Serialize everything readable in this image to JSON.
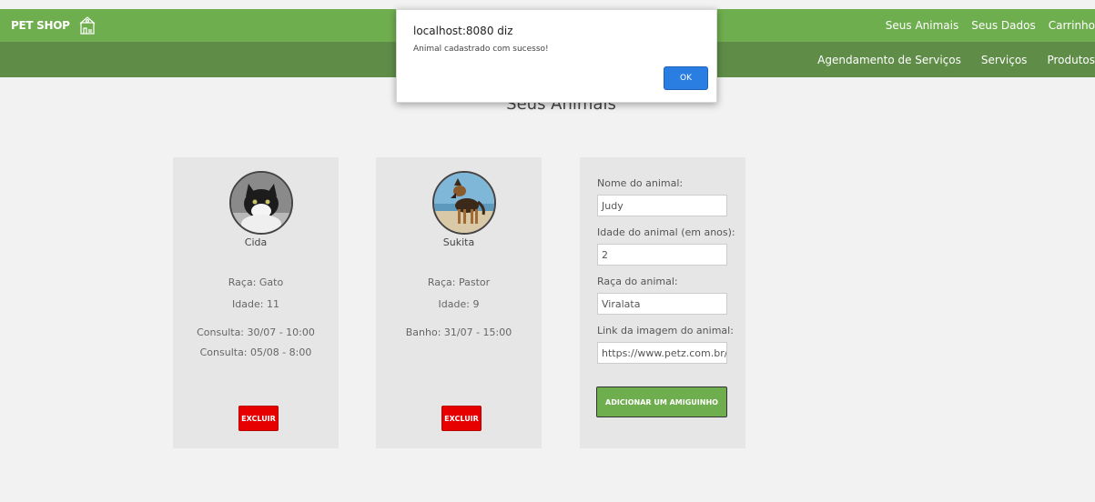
{
  "header": {
    "brand": "PET SHOP",
    "brand_icon": "pet-shop-logo-icon",
    "top_nav": [
      "Seus Animais",
      "Seus Dados",
      "Carrinho"
    ],
    "sub_nav": [
      "Agendamento de Serviços",
      "Serviços",
      "Produtos"
    ]
  },
  "page": {
    "title": "Seus Animais"
  },
  "pets": [
    {
      "name": "Cida",
      "photo": "cat-photo",
      "race": "Raça: Gato",
      "age": "Idade: 11",
      "appointments": [
        "Consulta: 30/07 - 10:00",
        "Consulta: 05/08 - 8:00"
      ],
      "delete_label": "EXCLUIR"
    },
    {
      "name": "Sukita",
      "photo": "dog-photo",
      "race": "Raça: Pastor",
      "age": "Idade: 9",
      "appointments": [
        "Banho: 31/07 - 15:00"
      ],
      "delete_label": "EXCLUIR"
    }
  ],
  "form": {
    "name_label": "Nome do animal:",
    "name_value": "Judy",
    "age_label": "Idade do animal (em anos):",
    "age_value": "2",
    "race_label": "Raça do animal:",
    "race_value": "Viralata",
    "image_label": "Link da imagem do animal:",
    "image_value": "https://www.petz.com.br/blog",
    "submit_label": "ADICIONAR UM AMIGUINHO"
  },
  "dialog": {
    "title": "localhost:8080 diz",
    "message": "Animal cadastrado com sucesso!",
    "ok_label": "OK"
  },
  "colors": {
    "header_green": "#6fae4f",
    "subheader_green": "#5f8d48",
    "delete_red": "#e60000",
    "dialog_blue": "#2a7de1"
  }
}
